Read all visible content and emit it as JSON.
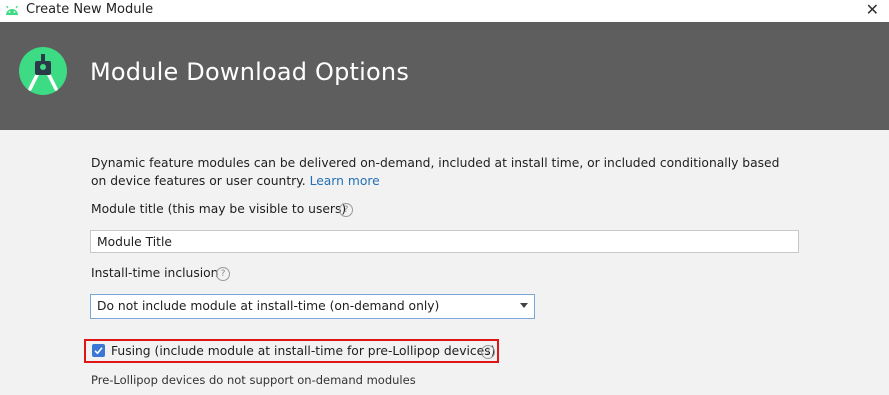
{
  "window": {
    "title": "Create New Module",
    "close_glyph": "✕"
  },
  "banner": {
    "title": "Module Download Options",
    "logo": "android-studio-logo"
  },
  "description": {
    "text": "Dynamic feature modules can be delivered on-demand, included at install time, or included conditionally based on device features or user country.",
    "link": "Learn more"
  },
  "module_title": {
    "label": "Module title (this may be visible to users)",
    "value": "Module Title",
    "help": "?"
  },
  "install_time": {
    "label": "Install-time inclusion",
    "selected": "Do not include module at install-time (on-demand only)",
    "help": "?"
  },
  "fusing": {
    "label": "Fusing (include module at install-time for pre-Lollipop devices)",
    "checked": true,
    "help": "?"
  },
  "note": "Pre-Lollipop devices do not support on-demand modules",
  "colors": {
    "banner": "#5e5e5e",
    "accent": "#3b78d6",
    "link": "#2470b3",
    "highlight": "#e01515",
    "android_green": "#3ddc84"
  }
}
